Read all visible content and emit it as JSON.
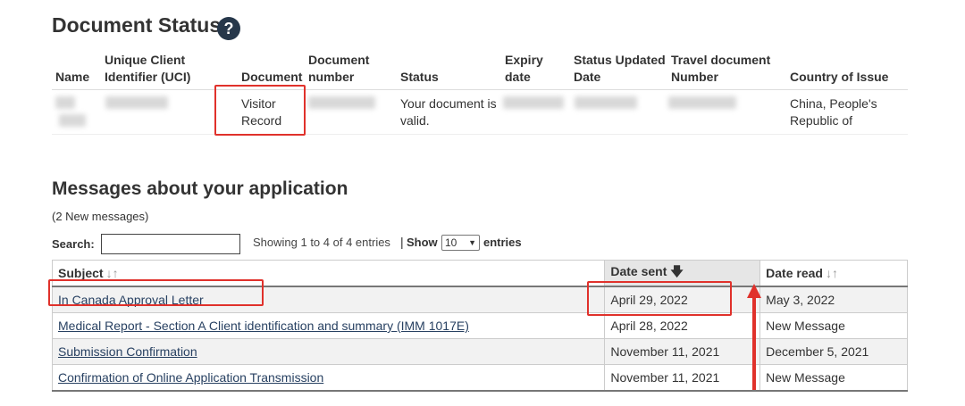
{
  "status": {
    "title": "Document Status",
    "help_glyph": "?",
    "columns": {
      "name": "Name",
      "uci_line1": "Unique Client",
      "uci_line2": "Identifier (UCI)",
      "document": "Document",
      "doc_number_line1": "Document",
      "doc_number_line2": "number",
      "status": "Status",
      "expiry_line1": "Expiry",
      "expiry_line2": "date",
      "updated_line1": "Status Updated",
      "updated_line2": "Date",
      "travel_line1": "Travel document",
      "travel_line2": "Number",
      "country": "Country of Issue"
    },
    "row": {
      "document_line1": "Visitor",
      "document_line2": "Record",
      "status_line1": "Your document is",
      "status_line2": "valid.",
      "country_line1": "China, People's",
      "country_line2": "Republic of"
    }
  },
  "messages": {
    "title": "Messages about your application",
    "new_count": "(2 New messages)",
    "search_label": "Search:",
    "search_value": "",
    "showing": "Showing 1 to 4 of 4 entries",
    "separator": "|",
    "show_label": "Show",
    "page_size": "10",
    "entries_label": "entries",
    "headers": {
      "subject": "Subject",
      "date_sent": "Date sent",
      "date_read": "Date read"
    },
    "rows": [
      {
        "subject": "In Canada Approval Letter",
        "date_sent": "April 29, 2022",
        "date_read": "May 3, 2022"
      },
      {
        "subject": "Medical Report - Section A Client identification and summary (IMM 1017E)",
        "date_sent": "April 28, 2022",
        "date_read": "New Message"
      },
      {
        "subject": "Submission Confirmation",
        "date_sent": "November 11, 2021",
        "date_read": "December 5, 2021"
      },
      {
        "subject": "Confirmation of Online Application Transmission",
        "date_sent": "November 11, 2021",
        "date_read": "New Message"
      }
    ]
  },
  "colors": {
    "annotation_red": "#e0312b",
    "link": "#284162",
    "help_icon_bg": "#26374a"
  }
}
